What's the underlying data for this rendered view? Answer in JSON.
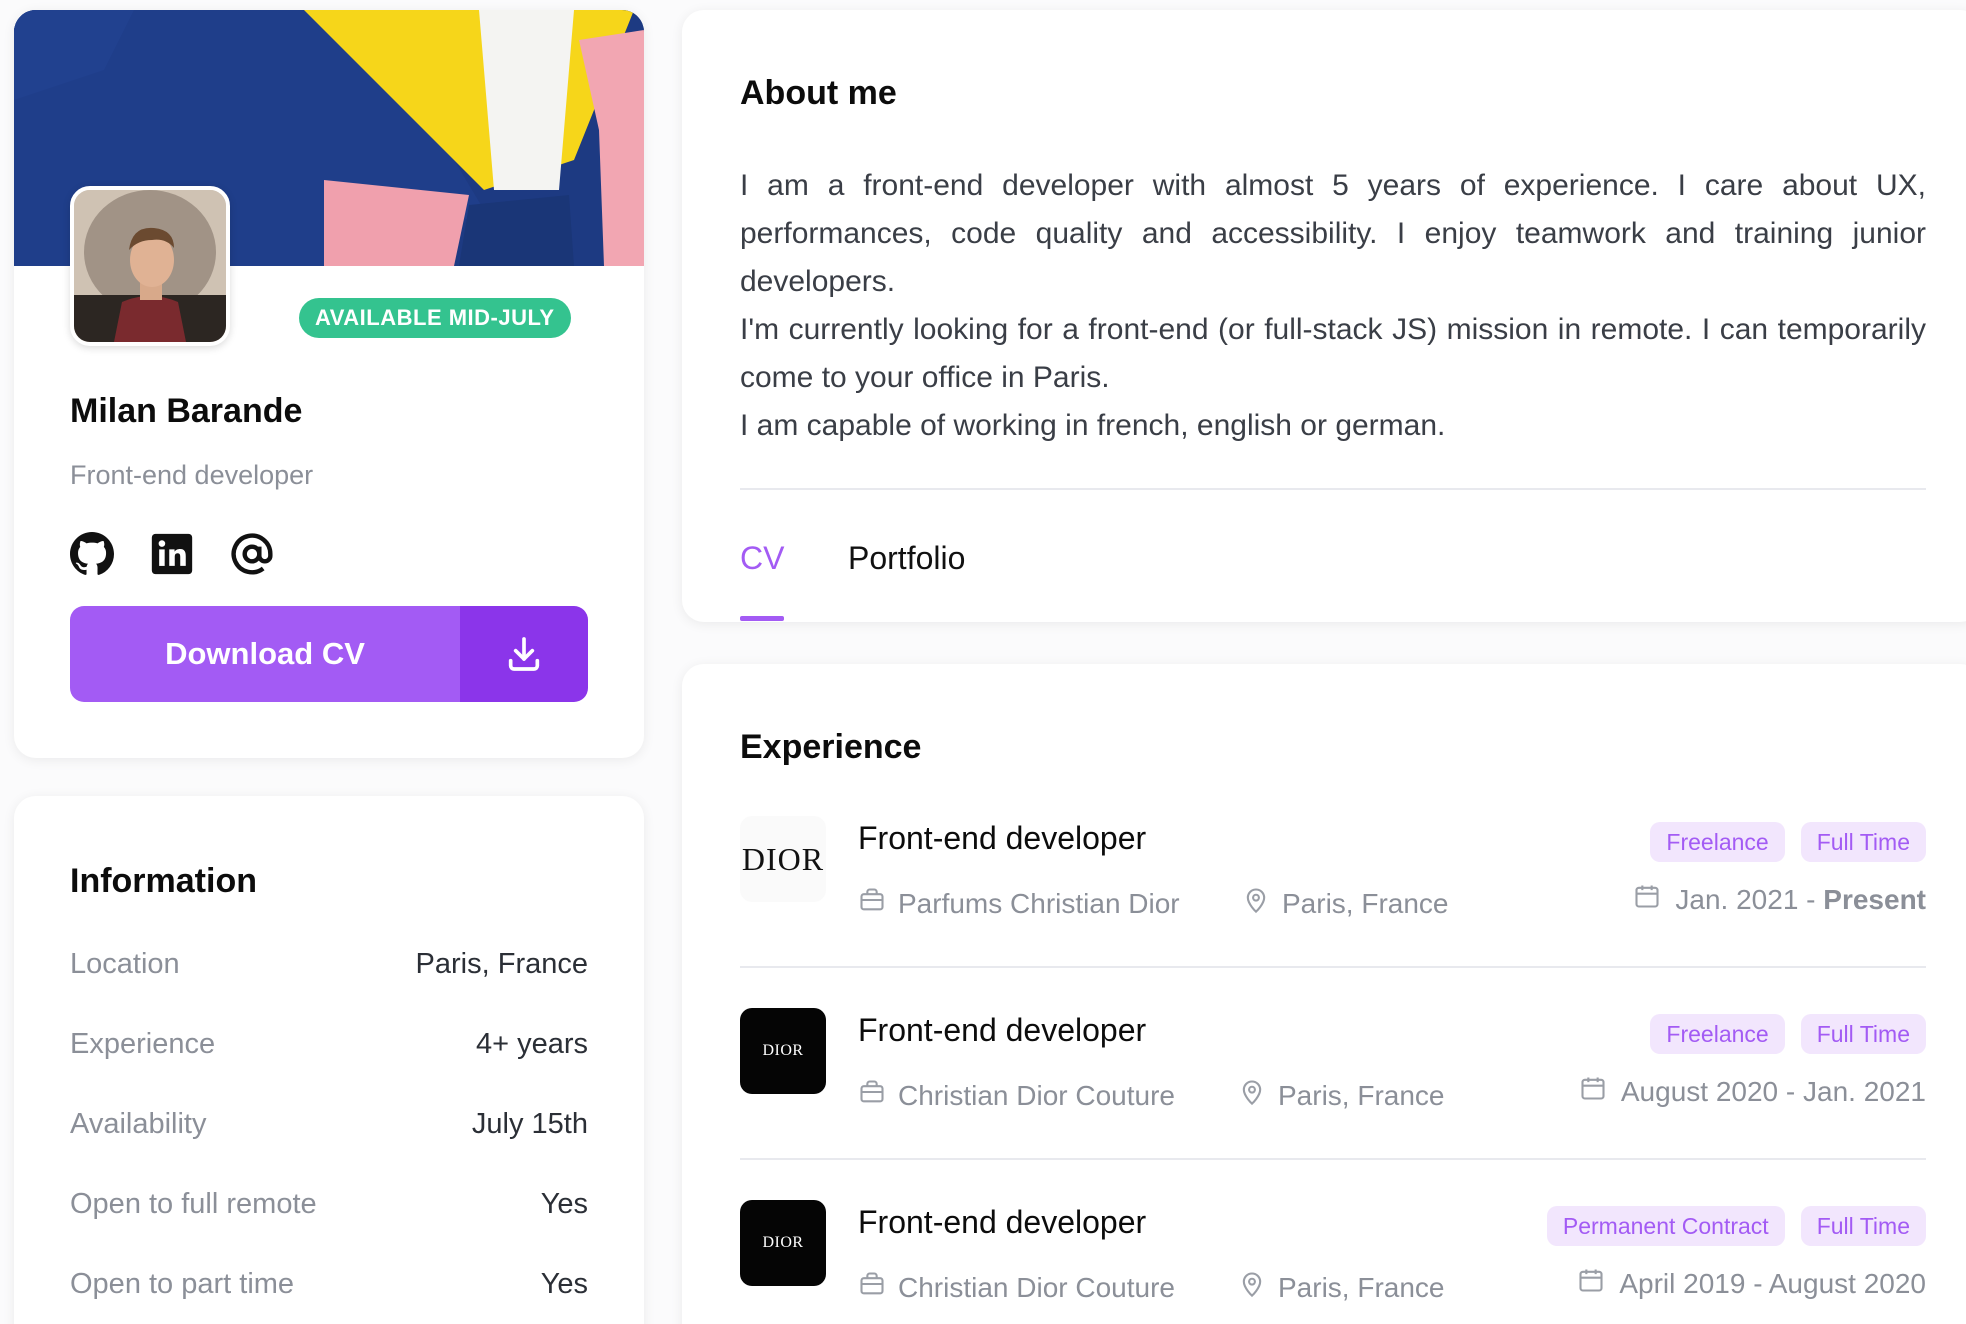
{
  "profile": {
    "availability_badge": "AVAILABLE MID-JULY",
    "name": "Milan Barande",
    "role": "Front-end developer",
    "socials": [
      "github-icon",
      "linkedin-icon",
      "at-icon"
    ],
    "download_label": "Download CV"
  },
  "information": {
    "title": "Information",
    "rows": [
      {
        "label": "Location",
        "value": "Paris, France"
      },
      {
        "label": "Experience",
        "value": "4+ years"
      },
      {
        "label": "Availability",
        "value": "July 15th"
      },
      {
        "label": "Open to full remote",
        "value": "Yes"
      },
      {
        "label": "Open to part time",
        "value": "Yes"
      }
    ]
  },
  "about": {
    "title": "About me",
    "paragraphs": [
      "I am a front-end developer with almost 5 years of experience. I care about UX, performances, code quality and accessibility. I enjoy teamwork and training junior developers.",
      "I'm currently looking for a front-end (or full-stack JS) mission in remote. I can temporarily come to your office in Paris.",
      "I am capable of working in french, english or german."
    ]
  },
  "tabs": {
    "cv": "CV",
    "portfolio": "Portfolio"
  },
  "experience": {
    "title": "Experience",
    "items": [
      {
        "logo_text": "DIOR",
        "title": "Front-end developer",
        "company": "Parfums Christian Dior",
        "location": "Paris, France",
        "tags": [
          "Freelance",
          "Full Time"
        ],
        "dates_start": "Jan. 2021 - ",
        "dates_end": "Present"
      },
      {
        "logo_text": "DIOR",
        "title": "Front-end developer",
        "company": "Christian Dior Couture",
        "location": "Paris, France",
        "tags": [
          "Freelance",
          "Full Time"
        ],
        "dates_start": "August 2020 - Jan. 2021",
        "dates_end": ""
      },
      {
        "logo_text": "DIOR",
        "title": "Front-end developer",
        "company": "Christian Dior Couture",
        "location": "Paris, France",
        "tags": [
          "Permanent Contract",
          "Full Time"
        ],
        "dates_start": "April 2019 - August 2020",
        "dates_end": ""
      }
    ]
  },
  "colors": {
    "accent": "#a35bf4",
    "accent_dark": "#8b35ea",
    "badge_green": "#34c38f",
    "tag_bg": "#f2e6fd"
  }
}
